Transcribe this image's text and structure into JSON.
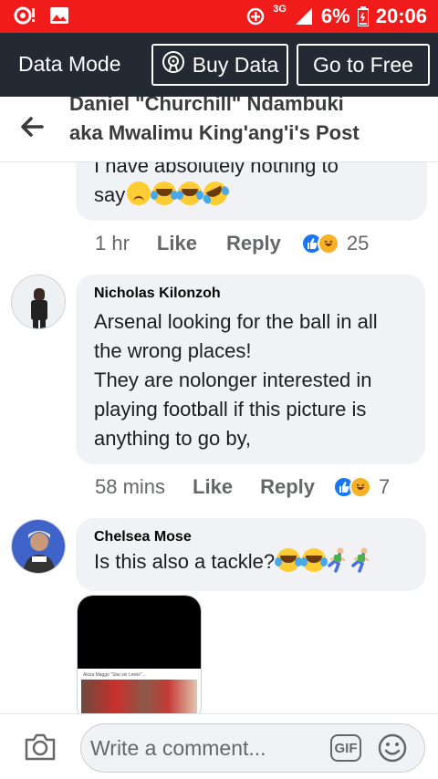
{
  "status_bar": {
    "network": "3G",
    "battery": "6%",
    "time": "20:06",
    "color": "#f01b1b"
  },
  "data_bar": {
    "title": "Data Mode",
    "buy_label": "Buy Data",
    "free_label": "Go to Free"
  },
  "header": {
    "title": "Daniel \"Churchill\" Ndambuki aka Mwalimu King'ang'i's Post"
  },
  "comments": [
    {
      "text_partial": "I have absolutely nothing to",
      "text_end": "say",
      "emojis": [
        "worried-face",
        "tears-of-joy",
        "tears-of-joy",
        "rolling-laughing"
      ],
      "time": "1 hr",
      "like_label": "Like",
      "reply_label": "Reply",
      "reactions": [
        "like",
        "haha"
      ],
      "reaction_count": "25"
    },
    {
      "author": "Nicholas Kilonzoh",
      "text": "Arsenal looking for the ball in all the wrong places!\nThey are nolonger interested in playing football if this picture is anything to go by,",
      "time": "58 mins",
      "like_label": "Like",
      "reply_label": "Reply",
      "reactions": [
        "like",
        "haha"
      ],
      "reaction_count": "7"
    },
    {
      "author": "Chelsea Mose",
      "text": "Is this also a tackle?",
      "emojis": [
        "tears-of-joy",
        "tears-of-joy",
        "runner",
        "runner"
      ],
      "attachment_caption": "Akiza Maggo \"Stai sio Lewis\"..."
    }
  ],
  "composer": {
    "placeholder": "Write a comment...",
    "gif_label": "GIF"
  },
  "colors": {
    "facebook_blue": "#1877f2",
    "bubble_bg": "#f0f2f5",
    "data_bar_bg": "#232a34"
  }
}
